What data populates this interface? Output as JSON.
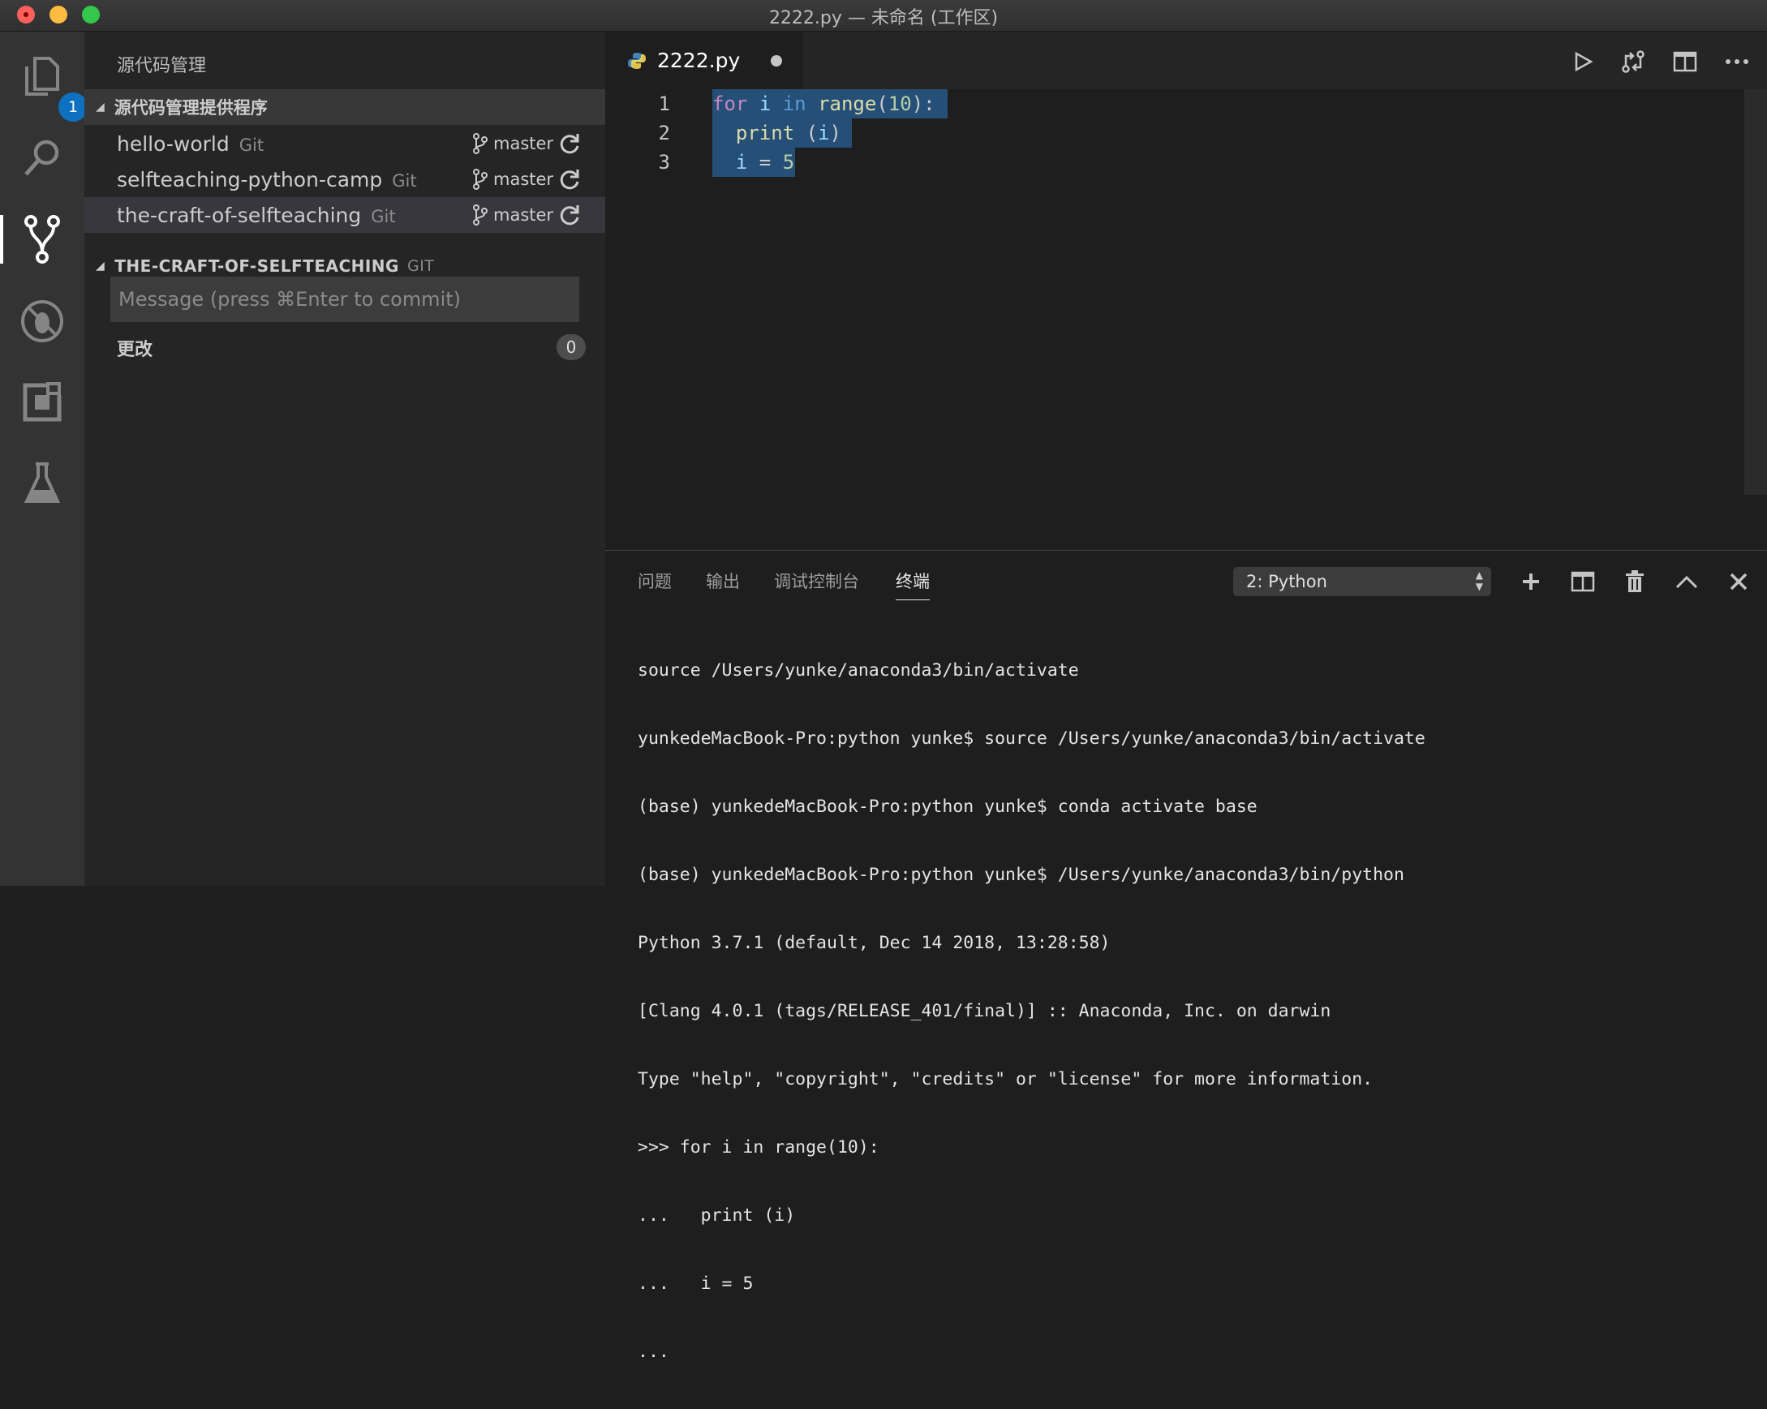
{
  "window": {
    "title": "2222.py — 未命名 (工作区)"
  },
  "activity_bar": {
    "items": [
      {
        "name": "explorer",
        "icon": "files-icon",
        "badge": "1"
      },
      {
        "name": "search",
        "icon": "search-icon"
      },
      {
        "name": "source-control",
        "icon": "source-control-icon",
        "active": true
      },
      {
        "name": "debug",
        "icon": "debug-icon"
      },
      {
        "name": "extensions",
        "icon": "extensions-icon"
      },
      {
        "name": "test",
        "icon": "flask-icon"
      }
    ]
  },
  "sidebar": {
    "title": "源代码管理",
    "providers_header": "源代码管理提供程序",
    "repos": [
      {
        "name": "hello-world",
        "type": "Git",
        "branch": "master"
      },
      {
        "name": "selfteaching-python-camp",
        "type": "Git",
        "branch": "master"
      },
      {
        "name": "the-craft-of-selfteaching",
        "type": "Git",
        "branch": "master"
      }
    ],
    "repo_section": {
      "name": "THE-CRAFT-OF-SELFTEACHING",
      "type": "GIT"
    },
    "commit_placeholder": "Message (press ⌘Enter to commit)",
    "changes_label": "更改",
    "changes_count": "0"
  },
  "editor": {
    "tab": {
      "filename": "2222.py",
      "dirty": true
    },
    "lines": [
      {
        "num": "1",
        "text": "for i in range(10):"
      },
      {
        "num": "2",
        "text": "  print (i)"
      },
      {
        "num": "3",
        "text": "  i = 5"
      }
    ]
  },
  "panel": {
    "tabs": [
      "问题",
      "输出",
      "调试控制台",
      "终端"
    ],
    "active_tab": "终端",
    "terminal_select": "2: Python",
    "terminal_lines": [
      "source /Users/yunke/anaconda3/bin/activate",
      "yunkedeMacBook-Pro:python yunke$ source /Users/yunke/anaconda3/bin/activate",
      "(base) yunkedeMacBook-Pro:python yunke$ conda activate base",
      "(base) yunkedeMacBook-Pro:python yunke$ /Users/yunke/anaconda3/bin/python",
      "Python 3.7.1 (default, Dec 14 2018, 13:28:58)",
      "[Clang 4.0.1 (tags/RELEASE_401/final)] :: Anaconda, Inc. on darwin",
      "Type \"help\", \"copyright\", \"credits\" or \"license\" for more information.",
      ">>> for i in range(10):",
      "...   print (i)",
      "...   i = 5",
      "..."
    ]
  },
  "colors": {
    "accent": "#0e70c0",
    "selection": "#264f78"
  }
}
